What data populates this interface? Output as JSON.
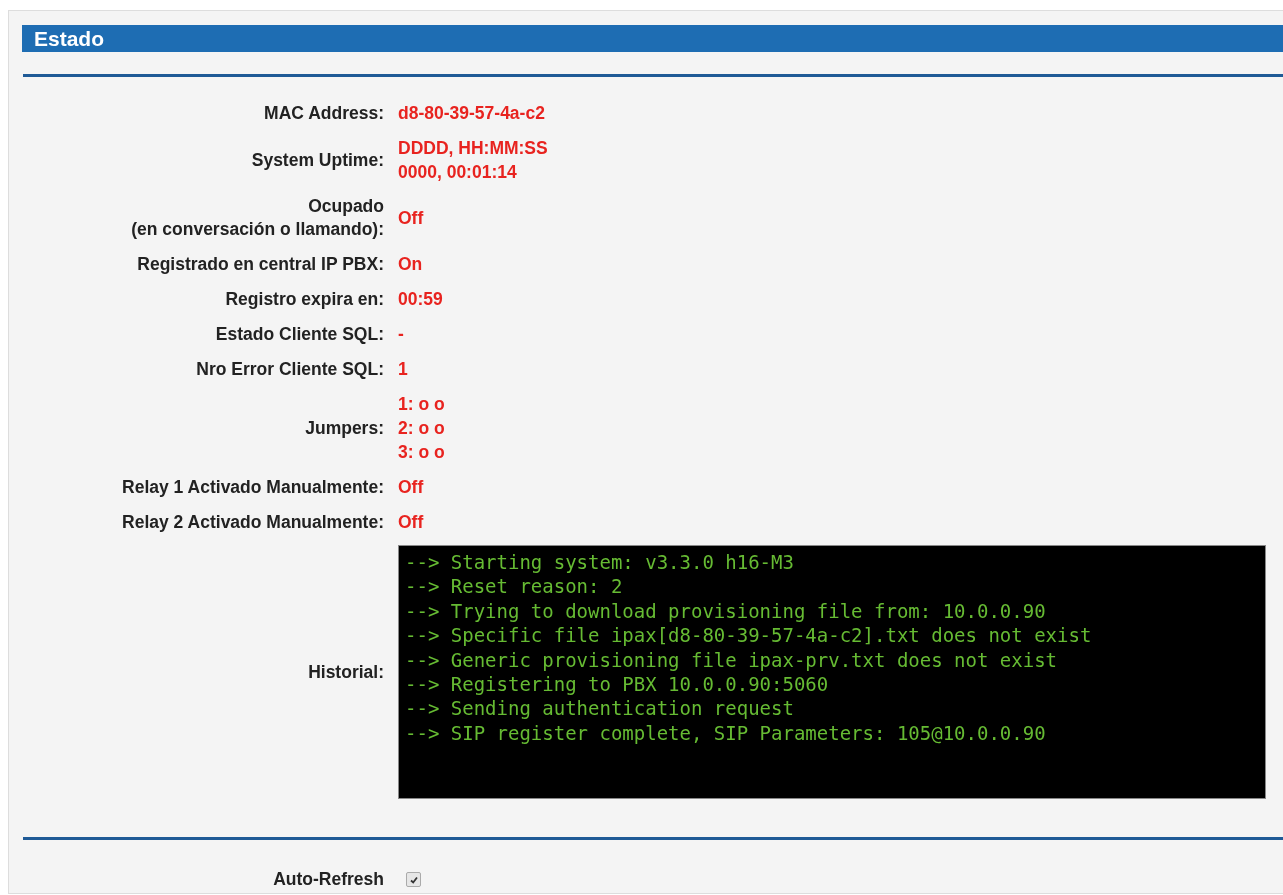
{
  "section": {
    "title": "Estado"
  },
  "rows": [
    {
      "kind": "text",
      "label": "MAC Address:",
      "lines": [
        "d8-80-39-57-4a-c2"
      ]
    },
    {
      "kind": "text",
      "label": "System Uptime:",
      "lines": [
        "DDDD, HH:MM:SS",
        "0000, 00:01:14"
      ]
    },
    {
      "kind": "text",
      "label": "Ocupado\n(en conversación o llamando):",
      "lines": [
        "Off"
      ]
    },
    {
      "kind": "text",
      "label": "Registrado en central IP PBX:",
      "lines": [
        "On"
      ]
    },
    {
      "kind": "text",
      "label": "Registro expira en:",
      "lines": [
        "00:59"
      ]
    },
    {
      "kind": "text",
      "label": "Estado Cliente SQL:",
      "lines": [
        "-"
      ]
    },
    {
      "kind": "text",
      "label": "Nro Error Cliente SQL:",
      "lines": [
        "1"
      ]
    },
    {
      "kind": "text",
      "label": "Jumpers:",
      "lines": [
        "1: o o",
        "2: o o",
        "3: o o"
      ]
    },
    {
      "kind": "text",
      "label": "Relay 1 Activado Manualmente:",
      "lines": [
        "Off"
      ]
    },
    {
      "kind": "text",
      "label": "Relay 2 Activado Manualmente:",
      "lines": [
        "Off"
      ]
    },
    {
      "kind": "log",
      "label": "Historial:",
      "lines": [
        "--> Starting system: v3.3.0 h16-M3",
        "--> Reset reason: 2",
        "--> Trying to download provisioning file from: 10.0.0.90",
        "--> Specific file ipax[d8-80-39-57-4a-c2].txt does not exist",
        "--> Generic provisioning file ipax-prv.txt does not exist",
        "--> Registering to PBX 10.0.0.90:5060",
        "--> Sending authentication request",
        "--> SIP register complete, SIP Parameters: 105@10.0.0.90"
      ]
    }
  ],
  "auto_refresh": {
    "label": "Auto-Refresh",
    "checked": true
  }
}
